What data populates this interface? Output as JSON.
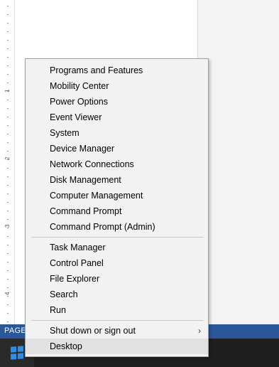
{
  "status_bar": {
    "page_label": "PAGE"
  },
  "ruler": {
    "numbers": [
      "1",
      "2",
      "3",
      "4"
    ]
  },
  "menu": {
    "groups": [
      [
        "Programs and Features",
        "Mobility Center",
        "Power Options",
        "Event Viewer",
        "System",
        "Device Manager",
        "Network Connections",
        "Disk Management",
        "Computer Management",
        "Command Prompt",
        "Command Prompt (Admin)"
      ],
      [
        "Task Manager",
        "Control Panel",
        "File Explorer",
        "Search",
        "Run"
      ],
      [
        "Shut down or sign out",
        "Desktop"
      ]
    ],
    "highlighted": "Desktop",
    "submenu_arrow": "›"
  },
  "taskbar": {
    "start_icon": "windows-logo-icon",
    "accent_color": "#2b8fe6"
  }
}
